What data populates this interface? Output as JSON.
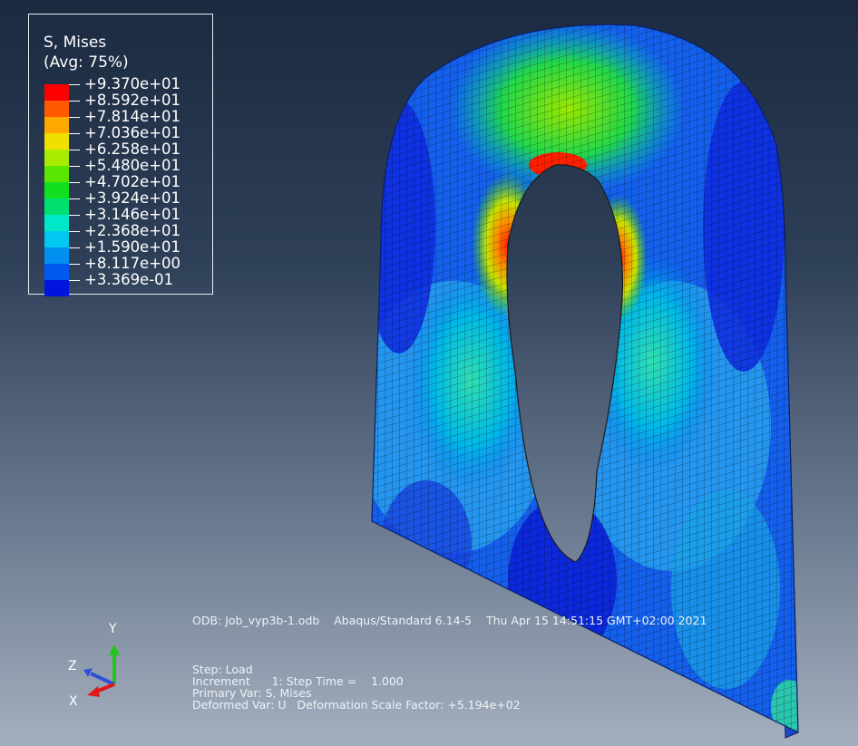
{
  "legend": {
    "title": "S, Mises",
    "subtitle": "(Avg: 75%)",
    "entries": [
      {
        "value": "+9.370e+01",
        "color": "#ff0000"
      },
      {
        "value": "+8.592e+01",
        "color": "#ff5a00"
      },
      {
        "value": "+7.814e+01",
        "color": "#ffa800"
      },
      {
        "value": "+7.036e+01",
        "color": "#f0e000"
      },
      {
        "value": "+6.258e+01",
        "color": "#a8ec00"
      },
      {
        "value": "+5.480e+01",
        "color": "#5ae600"
      },
      {
        "value": "+4.702e+01",
        "color": "#10e020"
      },
      {
        "value": "+3.924e+01",
        "color": "#00e070"
      },
      {
        "value": "+3.146e+01",
        "color": "#00e8c8"
      },
      {
        "value": "+2.368e+01",
        "color": "#00c8f0"
      },
      {
        "value": "+1.590e+01",
        "color": "#0090f0"
      },
      {
        "value": "+8.117e+00",
        "color": "#0058f0"
      },
      {
        "value": "+3.369e-01",
        "color": "#0014e0"
      }
    ]
  },
  "info": {
    "odb_line": "ODB: Job_vyp3b-1.odb    Abaqus/Standard 6.14-5    Thu Apr 15 14:51:15 GMT+02:00 2021",
    "step": "Step: Load",
    "increment": "Increment      1: Step Time =    1.000",
    "primary_var": "Primary Var: S, Mises",
    "deformed_var": "Deformed Var: U   Deformation Scale Factor: +5.194e+02"
  },
  "triad": {
    "y": "Y",
    "z": "Z",
    "x": "X",
    "y_color": "#22c41a",
    "z_color": "#3050d8",
    "x_color": "#e01818"
  },
  "model_colors": {
    "background_top": "#1b2a40",
    "background_bottom": "#a4afbd",
    "mesh": "#000000",
    "edge": "#1b3a8c"
  }
}
